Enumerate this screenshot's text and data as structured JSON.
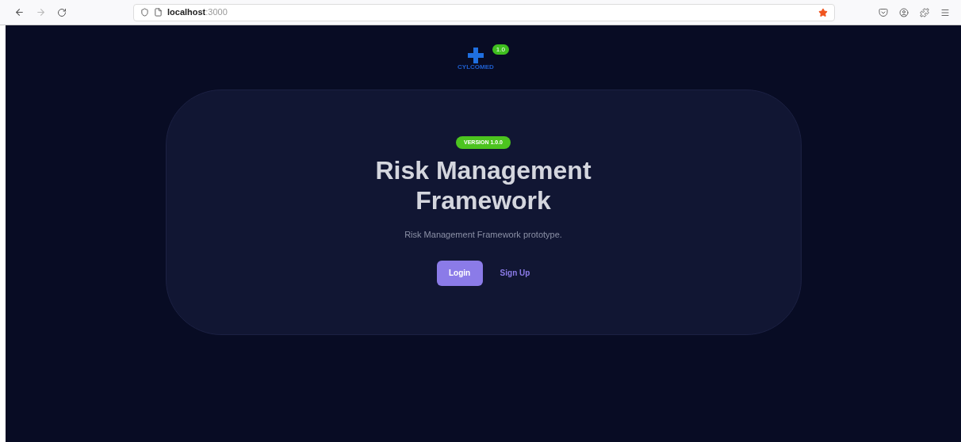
{
  "browser": {
    "url_host": "localhost",
    "url_port": ":3000",
    "bookmarked": true
  },
  "header": {
    "logo_text": "CYLCOMED",
    "badge": "1.0"
  },
  "hero": {
    "version": "VERSION 1.0.0",
    "title": "Risk Management Framework",
    "subtitle": "Risk Management Framework prototype.",
    "buttons": [
      {
        "label": "Login",
        "kind": "primary"
      },
      {
        "label": "Sign Up",
        "kind": "link"
      }
    ]
  }
}
